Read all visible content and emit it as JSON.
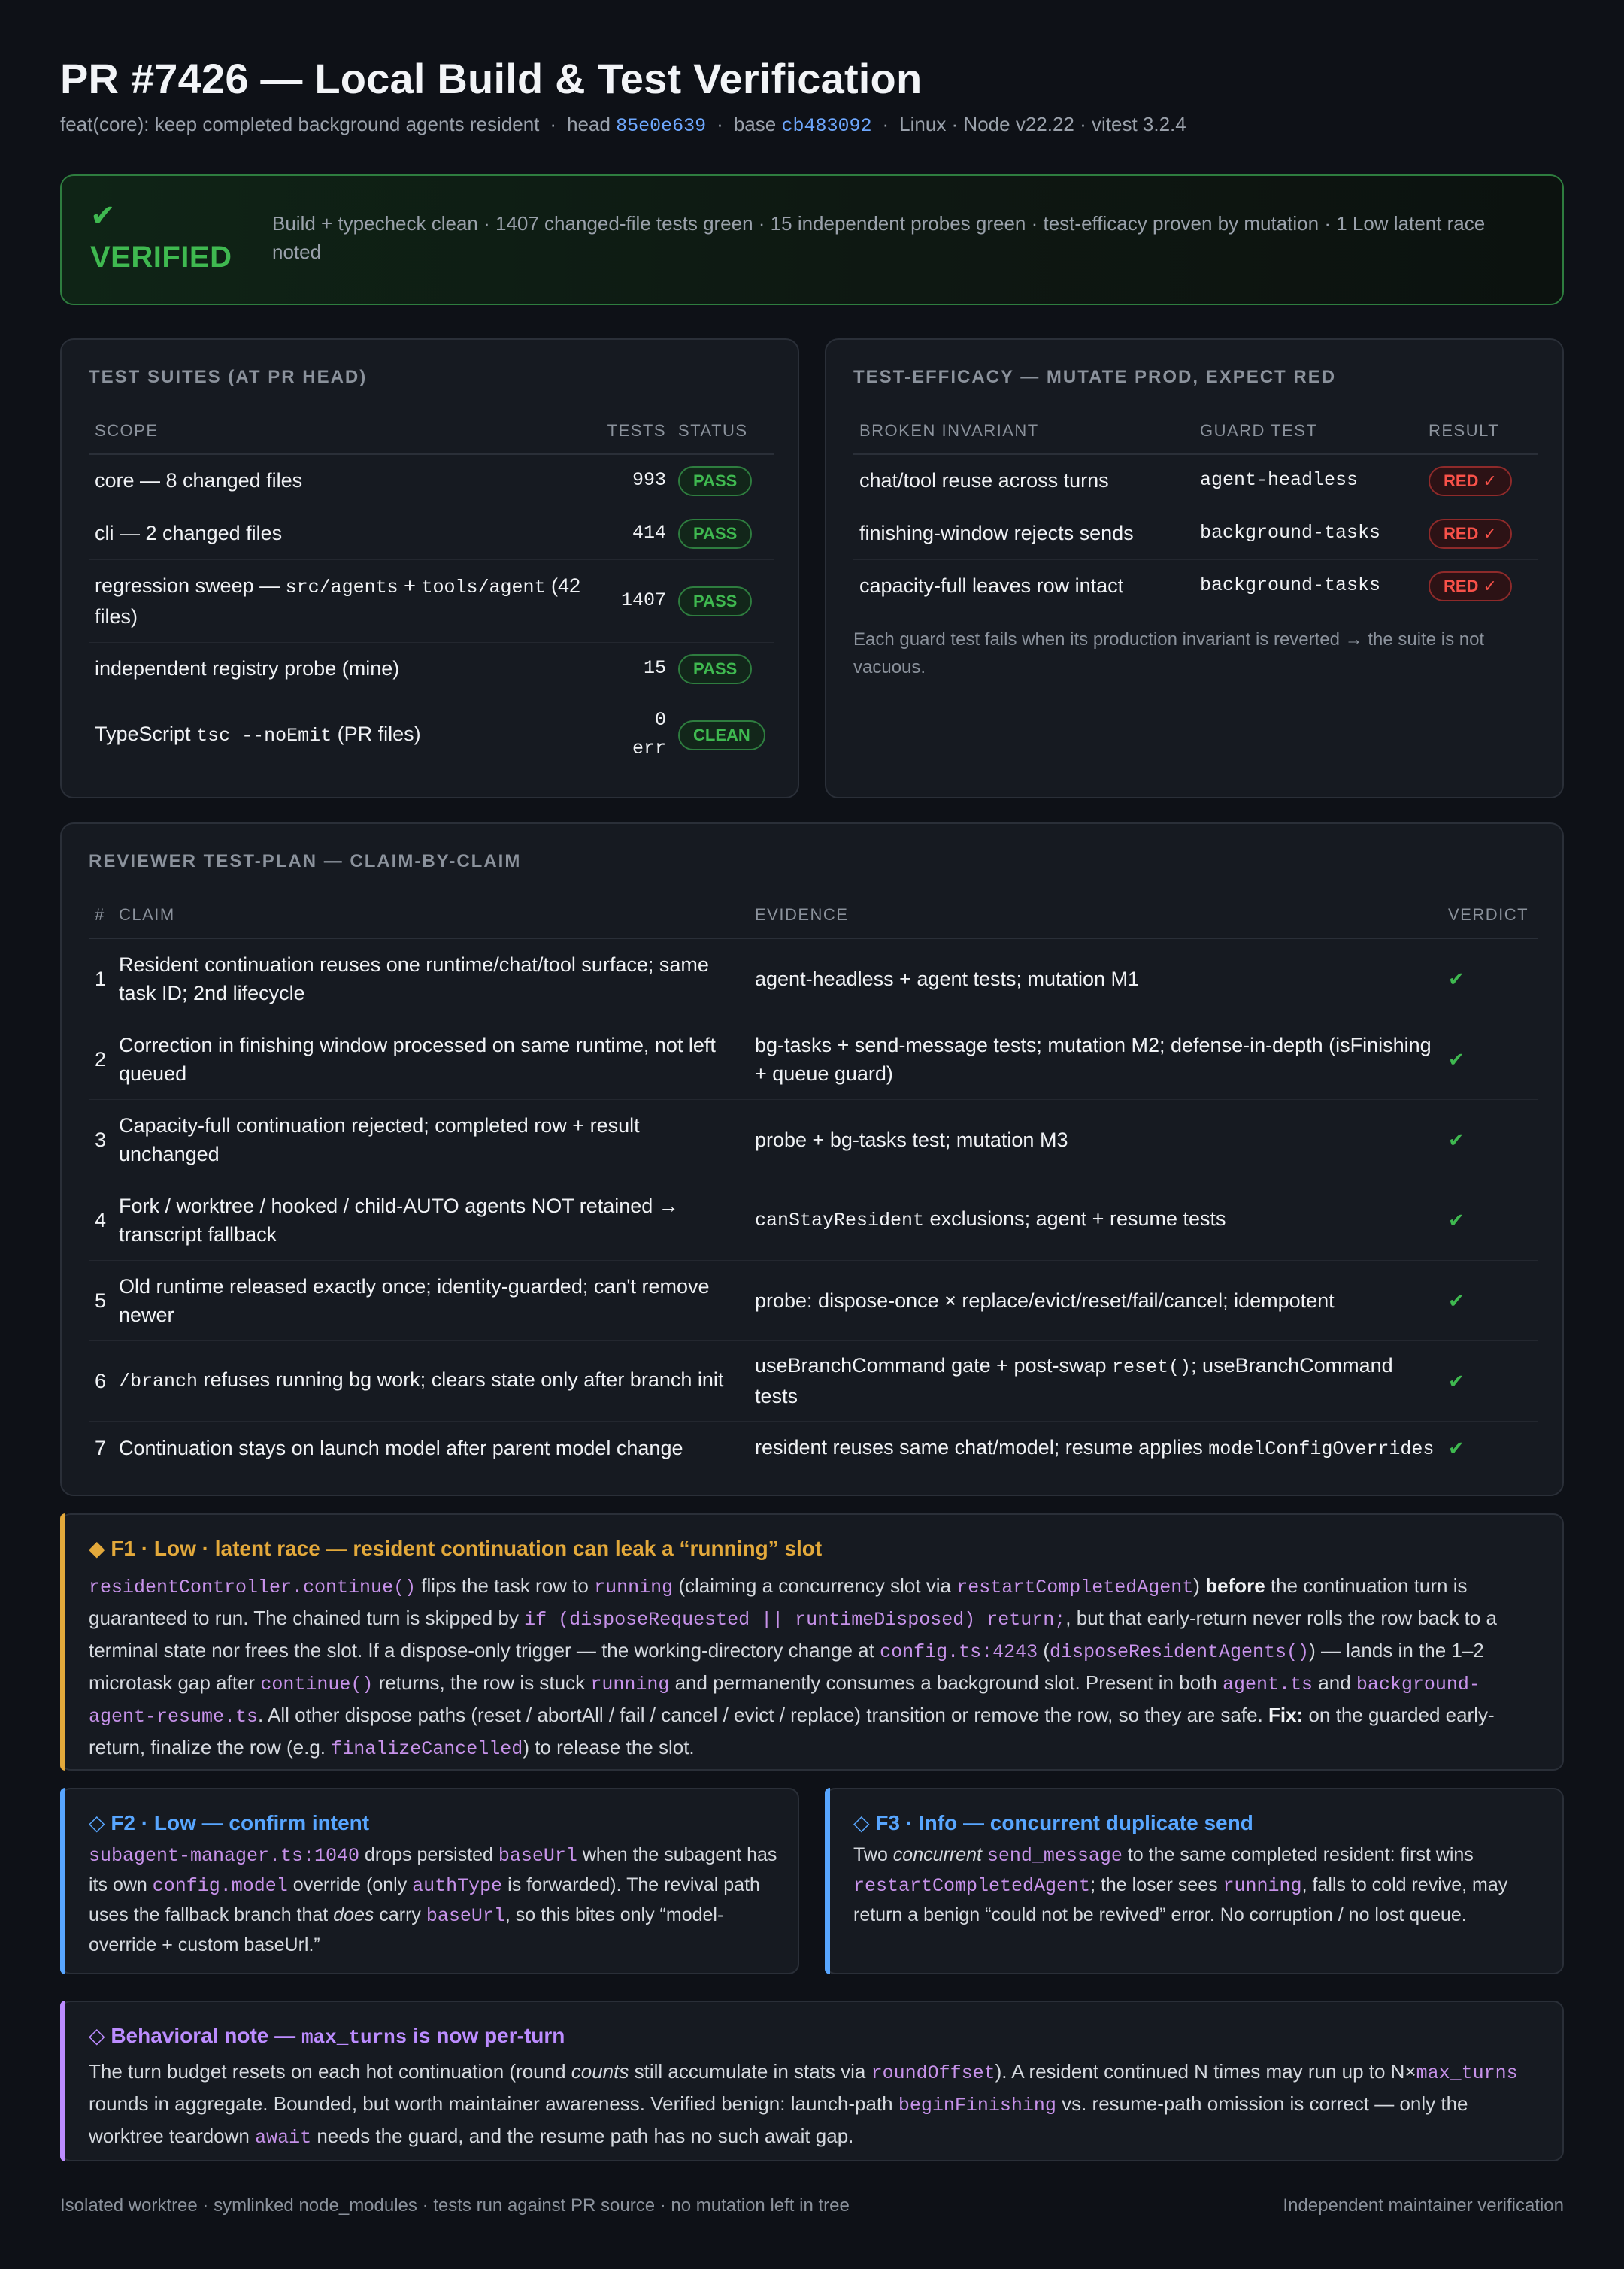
{
  "header": {
    "title": "PR #7426 — Local Build & Test Verification",
    "subtitle_desc": "feat(core): keep completed background agents resident",
    "head_label": "head",
    "head_sha": "85e0e639",
    "base_label": "base",
    "base_sha": "cb483092",
    "env": "Linux · Node v22.22 · vitest 3.2.4"
  },
  "banner": {
    "check": "✔",
    "status": "VERIFIED",
    "summary": "Build + typecheck clean · 1407 changed-file tests green · 15 independent probes green · test-efficacy proven by mutation · 1 Low latent race noted",
    "color": "#3fb950"
  },
  "suites": {
    "title": "TEST SUITES (AT PR HEAD)",
    "headers": {
      "scope": "SCOPE",
      "tests": "TESTS",
      "status": "STATUS"
    },
    "rows": [
      {
        "scope": "core — 8 changed files",
        "tests": "993",
        "status": "PASS"
      },
      {
        "scope": "cli — 2 changed files",
        "tests": "414",
        "status": "PASS"
      },
      {
        "scope_a": "regression sweep — ",
        "code1": "src/agents",
        "plus": " + ",
        "code2": "tools/agent",
        "scope_b": " (42 files)",
        "tests": "1407",
        "status": "PASS"
      },
      {
        "scope": "independent registry probe (mine)",
        "tests": "15",
        "status": "PASS"
      },
      {
        "scope_a": "TypeScript ",
        "code": "tsc --noEmit",
        "scope_b": " (PR files)",
        "tests_a": "0",
        "tests_b": "err",
        "status": "CLEAN"
      }
    ]
  },
  "efficacy": {
    "title": "TEST-EFFICACY — MUTATE PROD, EXPECT RED",
    "headers": {
      "invariant": "BROKEN INVARIANT",
      "guard": "GUARD TEST",
      "result": "RESULT"
    },
    "rows": [
      {
        "invariant": "chat/tool reuse across turns",
        "guard": "agent-headless",
        "result": "RED ✓"
      },
      {
        "invariant": "finishing-window rejects sends",
        "guard": "background-tasks",
        "result": "RED ✓"
      },
      {
        "invariant": "capacity-full leaves row intact",
        "guard": "background-tasks",
        "result": "RED ✓"
      }
    ],
    "note": "Each guard test fails when its production invariant is reverted → the suite is not vacuous."
  },
  "plan": {
    "title": "REVIEWER TEST-PLAN — CLAIM-BY-CLAIM",
    "headers": {
      "num": "#",
      "claim": "CLAIM",
      "evidence": "EVIDENCE",
      "verdict": "VERDICT"
    },
    "rows": [
      {
        "num": "1",
        "claim": "Resident continuation reuses one runtime/chat/tool surface; same task ID; 2nd lifecycle",
        "evidence": "agent-headless + agent tests; mutation M1",
        "verdict": "✔"
      },
      {
        "num": "2",
        "claim": "Correction in finishing window processed on same runtime, not left queued",
        "evidence": "bg-tasks + send-message tests; mutation M2; defense-in-depth (isFinishing + queue guard)",
        "verdict": "✔"
      },
      {
        "num": "3",
        "claim": "Capacity-full continuation rejected; completed row + result unchanged",
        "evidence": "probe + bg-tasks test; mutation M3",
        "verdict": "✔"
      },
      {
        "num": "4",
        "claim": "Fork / worktree / hooked / child-AUTO agents NOT retained → transcript fallback",
        "evidence_code": "canStayResident",
        "evidence_rest": " exclusions; agent + resume tests",
        "verdict": "✔"
      },
      {
        "num": "5",
        "claim": "Old runtime released exactly once; identity-guarded; can't remove newer",
        "evidence": "probe: dispose-once × replace/evict/reset/fail/cancel; idempotent",
        "verdict": "✔"
      },
      {
        "num": "6",
        "claim_code": "/branch",
        "claim_rest": " refuses running bg work; clears state only after branch init",
        "evidence_a": "useBranchCommand gate + post-swap ",
        "evidence_code": "reset()",
        "evidence_b": "; useBranchCommand tests",
        "verdict": "✔"
      },
      {
        "num": "7",
        "claim": "Continuation stays on launch model after parent model change",
        "evidence_a": "resident reuses same chat/model; resume applies ",
        "evidence_code": "modelConfigOverrides",
        "verdict": "✔"
      }
    ]
  },
  "f1": {
    "title": "◆ F1 · Low · latent race — resident continuation can leak a “running” slot",
    "color": "#e3a93b",
    "c1": "residentController.continue()",
    "t1": " flips the task row to ",
    "c2": "running",
    "t2": " (claiming a concurrency slot via ",
    "c3": "restartCompletedAgent",
    "t3": ") ",
    "b1": "before",
    "t4": " the continuation turn is guaranteed to run. The chained turn is skipped by ",
    "c4": "if (disposeRequested || runtimeDisposed) return;",
    "t5": ", but that early-return never rolls the row back to a terminal state nor frees the slot. If a dispose-only trigger — the working-directory change at ",
    "c5": "config.ts:4243",
    "t6": " (",
    "c6": "disposeResidentAgents()",
    "t7": ") — lands in the 1–2 microtask gap after ",
    "c7": "continue()",
    "t8": " returns, the row is stuck ",
    "c8": "running",
    "t9": " and permanently consumes a background slot. Present in both ",
    "c9": "agent.ts",
    "t10": " and ",
    "c10": "background-agent-resume.ts",
    "t11": ". All other dispose paths (reset / abortAll / fail / cancel / evict / replace) transition or remove the row, so they are safe. ",
    "b2": "Fix:",
    "t12": " on the guarded early-return, finalize the row (e.g. ",
    "c11": "finalizeCancelled",
    "t13": ") to release the slot."
  },
  "f2": {
    "title": "◇ F2 · Low — confirm intent",
    "color": "#58a6ff",
    "c1": "subagent-manager.ts:1040",
    "t1": " drops persisted ",
    "c2": "baseUrl",
    "t2": " when the subagent has its own ",
    "c3": "config.model",
    "t3": " override (only ",
    "c4": "authType",
    "t4": " is forwarded). The revival path uses the fallback branch that ",
    "i1": "does",
    "t5": " carry ",
    "c5": "baseUrl",
    "t6": ", so this bites only “model-override + custom baseUrl.”"
  },
  "f3": {
    "title": "◇ F3 · Info — concurrent duplicate send",
    "color": "#58a6ff",
    "t1": "Two ",
    "i1": "concurrent",
    "t1b": " ",
    "c1": "send_message",
    "t2": " to the same completed resident: first wins ",
    "c2": "restartCompletedAgent",
    "t3": "; the loser sees ",
    "c3": "running",
    "t4": ", falls to cold revive, may return a benign “could not be revived” error. No corruption / no lost queue."
  },
  "note": {
    "title_a": "◇ Behavioral note — ",
    "title_code": "max_turns",
    "title_b": " is now per-turn",
    "color": "#bc8cff",
    "t1": "The turn budget resets on each hot continuation (round ",
    "i1": "counts",
    "t2": " still accumulate in stats via ",
    "c1": "roundOffset",
    "t3": "). A resident continued N times may run up to N×",
    "c2": "max_turns",
    "t4": " rounds in aggregate. Bounded, but worth maintainer awareness. Verified benign: launch-path ",
    "c3": "beginFinishing",
    "t5": " vs. resume-path omission is correct — only the worktree teardown ",
    "c4": "await",
    "t6": " needs the guard, and the resume path has no such await gap."
  },
  "footer": {
    "left": "Isolated worktree · symlinked node_modules · tests run against PR source · no mutation left in tree",
    "right": "Independent maintainer verification"
  }
}
